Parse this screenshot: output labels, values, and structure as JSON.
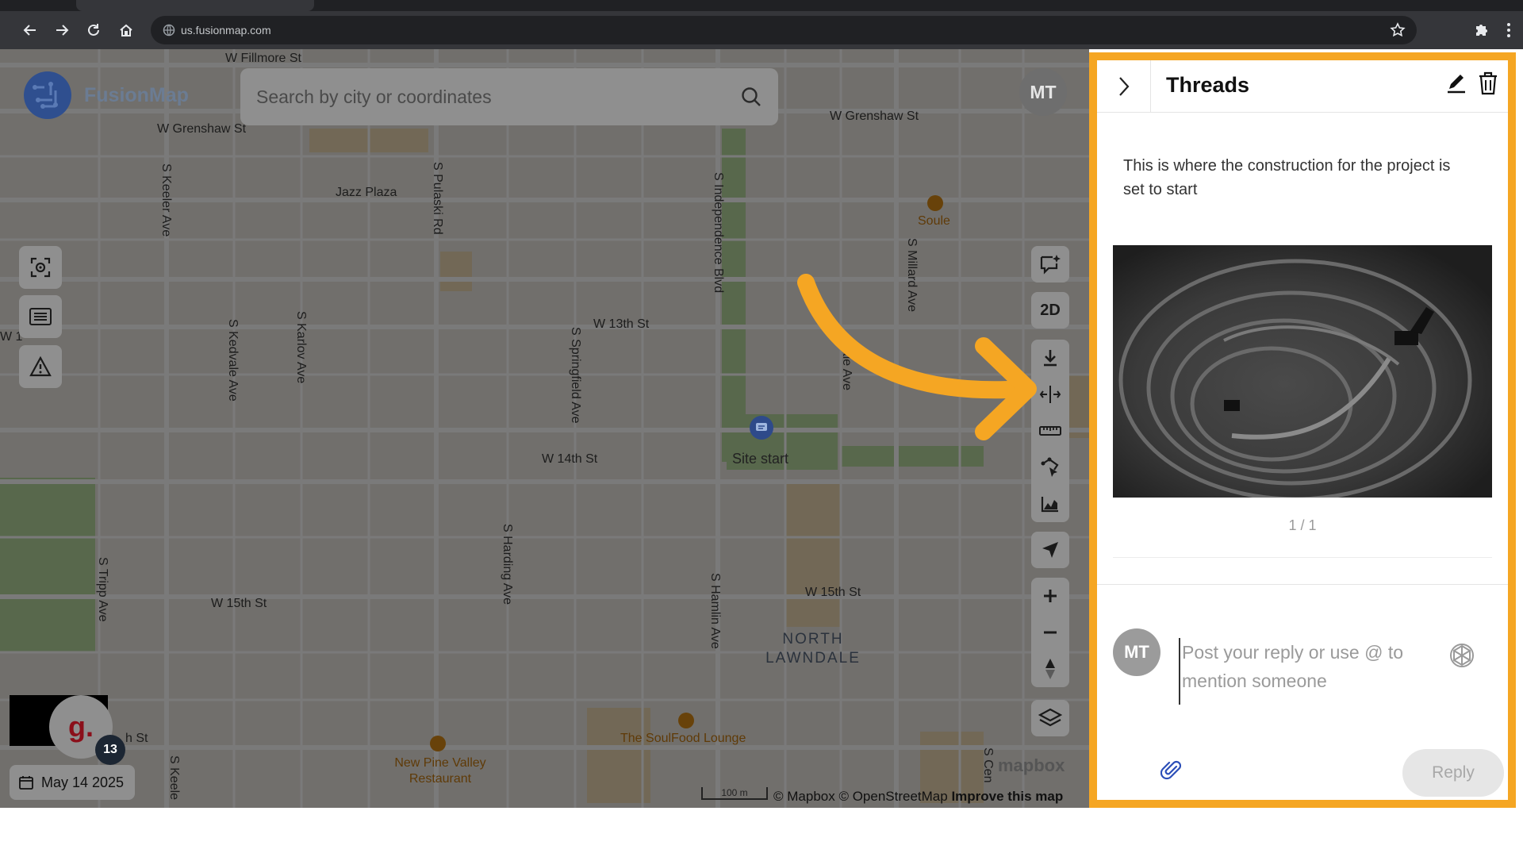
{
  "browser": {
    "url": "us.fusionmap.com"
  },
  "app": {
    "logo_text": "FusionMap",
    "user_initials": "MT"
  },
  "search": {
    "placeholder": "Search by city or coordinates"
  },
  "map": {
    "streets": [
      "W Fillmore St",
      "W Grenshaw St",
      "W Grenshaw St",
      "Jazz Plaza",
      "W 13th St",
      "W 14th St",
      "W 15th St",
      "W 15th St",
      "S Keeler Ave",
      "S Pulaski Rd",
      "S Independence Blvd",
      "S Millard Ave",
      "S Kedvale Ave",
      "S Karlov Ave",
      "S Springfield Ave",
      "S Harding Ave",
      "S Hamlin Ave",
      "S Tripp Ave",
      "S Keele",
      "S Cen",
      "W 1",
      "h St",
      "ndale Ave"
    ],
    "pois": [
      "Soule",
      "The SoulFood Lounge",
      "New Pine Valley Restaurant"
    ],
    "neighborhood": "NORTH LAWNDALE",
    "site_label": "Site start",
    "scale_label": "100 m",
    "attribution": "© Mapbox © OpenStreetMap",
    "improve": "Improve this map",
    "mapbox": "mapbox"
  },
  "tools": {
    "view_mode": "2D"
  },
  "bottom_left": {
    "date": "May 14 2025",
    "badge_letter": "g.",
    "badge_count": "13"
  },
  "threads": {
    "title": "Threads",
    "message": "This is where the construction for the project is set to start",
    "pager": "1 / 1",
    "reply_initials": "MT",
    "reply_placeholder": "Post your reply or use @ to mention someone",
    "reply_button": "Reply"
  },
  "colors": {
    "highlight_border": "#f5a623",
    "arrow": "#f5a623"
  }
}
